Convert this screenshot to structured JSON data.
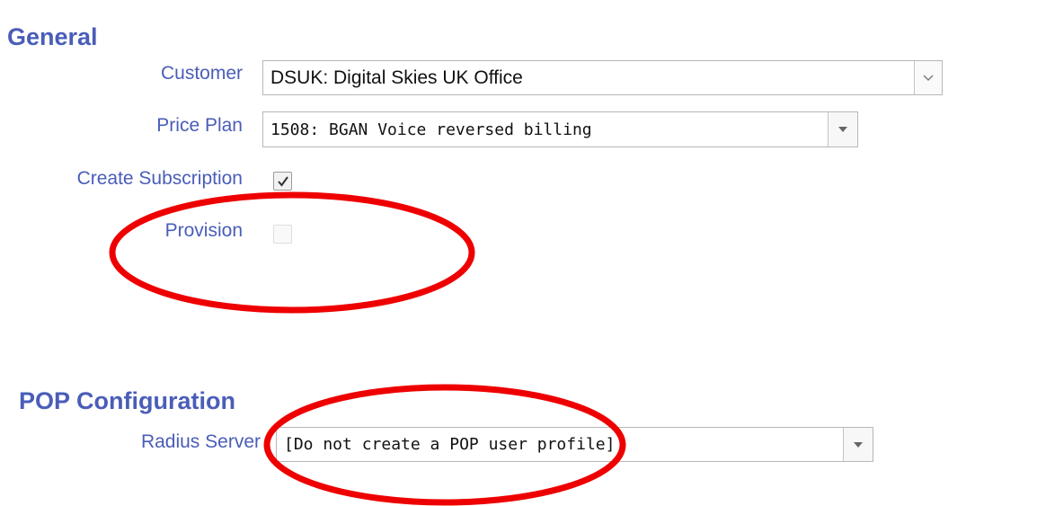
{
  "general": {
    "title": "General",
    "customer": {
      "label": "Customer",
      "value": "DSUK: Digital Skies UK Office",
      "icon": "chevron-down-icon"
    },
    "price_plan": {
      "label": "Price Plan",
      "value": "1508: BGAN Voice reversed billing",
      "icon": "caret-down-icon"
    },
    "create_subscription": {
      "label": "Create Subscription",
      "checked": true,
      "enabled": true
    },
    "provision": {
      "label": "Provision",
      "checked": false,
      "enabled": false
    }
  },
  "pop_configuration": {
    "title": "POP Configuration",
    "radius_server": {
      "label": "Radius Server",
      "value": "[Do not create a POP user profile]",
      "icon": "caret-down-icon"
    }
  },
  "annotations": {
    "highlight_color": "#ee0000",
    "shape": "ellipse-outline"
  },
  "colors": {
    "label": "#4a5db8",
    "heading": "#4a5db8",
    "border": "#b7b7b7"
  }
}
